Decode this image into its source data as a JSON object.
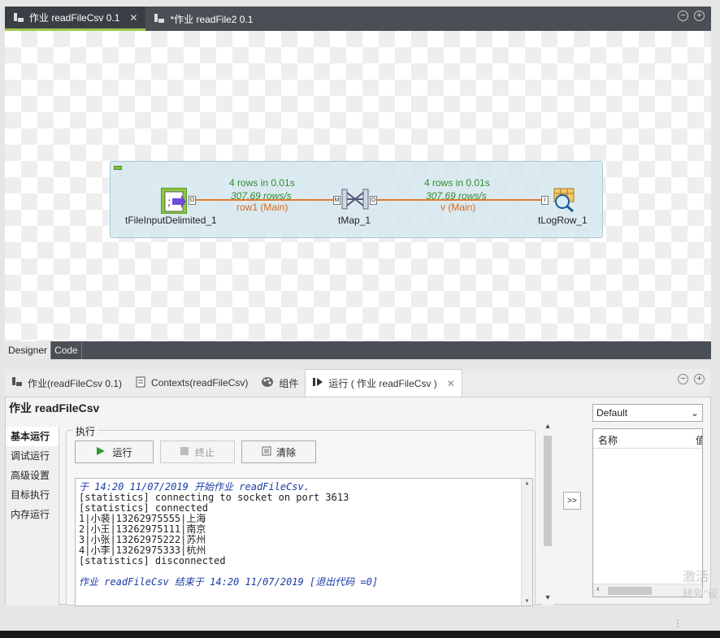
{
  "editor_tabs": [
    {
      "label": "作业 readFileCsv 0.1",
      "active": true
    },
    {
      "label": "*作业 readFile2 0.1",
      "active": false
    }
  ],
  "job": {
    "components": {
      "input": "tFileInputDelimited_1",
      "map": "tMap_1",
      "log": "tLogRow_1"
    },
    "links": [
      {
        "rows": "4 rows in 0.01s",
        "rate": "307.69 rows/s",
        "name": "row1 (Main)"
      },
      {
        "rows": "4 rows in 0.01s",
        "rate": "307.69 rows/s",
        "name": "v (Main)"
      }
    ],
    "port_labels": {
      "o": "O",
      "m": "M",
      "i": "I"
    }
  },
  "view_tabs": {
    "designer": "Designer",
    "code": "Code"
  },
  "bottom_tabs": [
    {
      "label": "作业(readFileCsv 0.1)",
      "active": false
    },
    {
      "label": "Contexts(readFileCsv)",
      "active": false
    },
    {
      "label": "组件",
      "active": false
    },
    {
      "label": "运行 ( 作业 readFileCsv )",
      "active": true
    }
  ],
  "run_panel": {
    "title": "作业 readFileCsv",
    "nav": [
      "基本运行",
      "调试运行",
      "高级设置",
      "目标执行",
      "内存运行"
    ],
    "group_label": "执行",
    "buttons": {
      "run": "运行",
      "stop": "终止",
      "clear": "清除"
    },
    "console": [
      "于 14:20 11/07/2019 开始作业 readFileCsv.",
      "[statistics] connecting to socket on port 3613",
      "[statistics] connected",
      "1|小裴|13262975555|上海",
      "2|小王|13262975111|南京",
      "3|小张|13262975222|苏州",
      "4|小李|13262975333|杭州",
      "[statistics] disconnected",
      "",
      "作业 readFileCsv 结束于 14:20 11/07/2019 [退出代码 =0]"
    ],
    "expand_label": ">>",
    "context_select": "Default",
    "table_header": "名称",
    "table_header_2": "值"
  },
  "watermark": {
    "line1": "激活",
    "line2": "转到\"设"
  },
  "colors": {
    "accent": "#9bc84b",
    "link_orange": "#e07b2c",
    "stat_green": "#2e8b2e",
    "console_blue": "#1a3aa6"
  }
}
